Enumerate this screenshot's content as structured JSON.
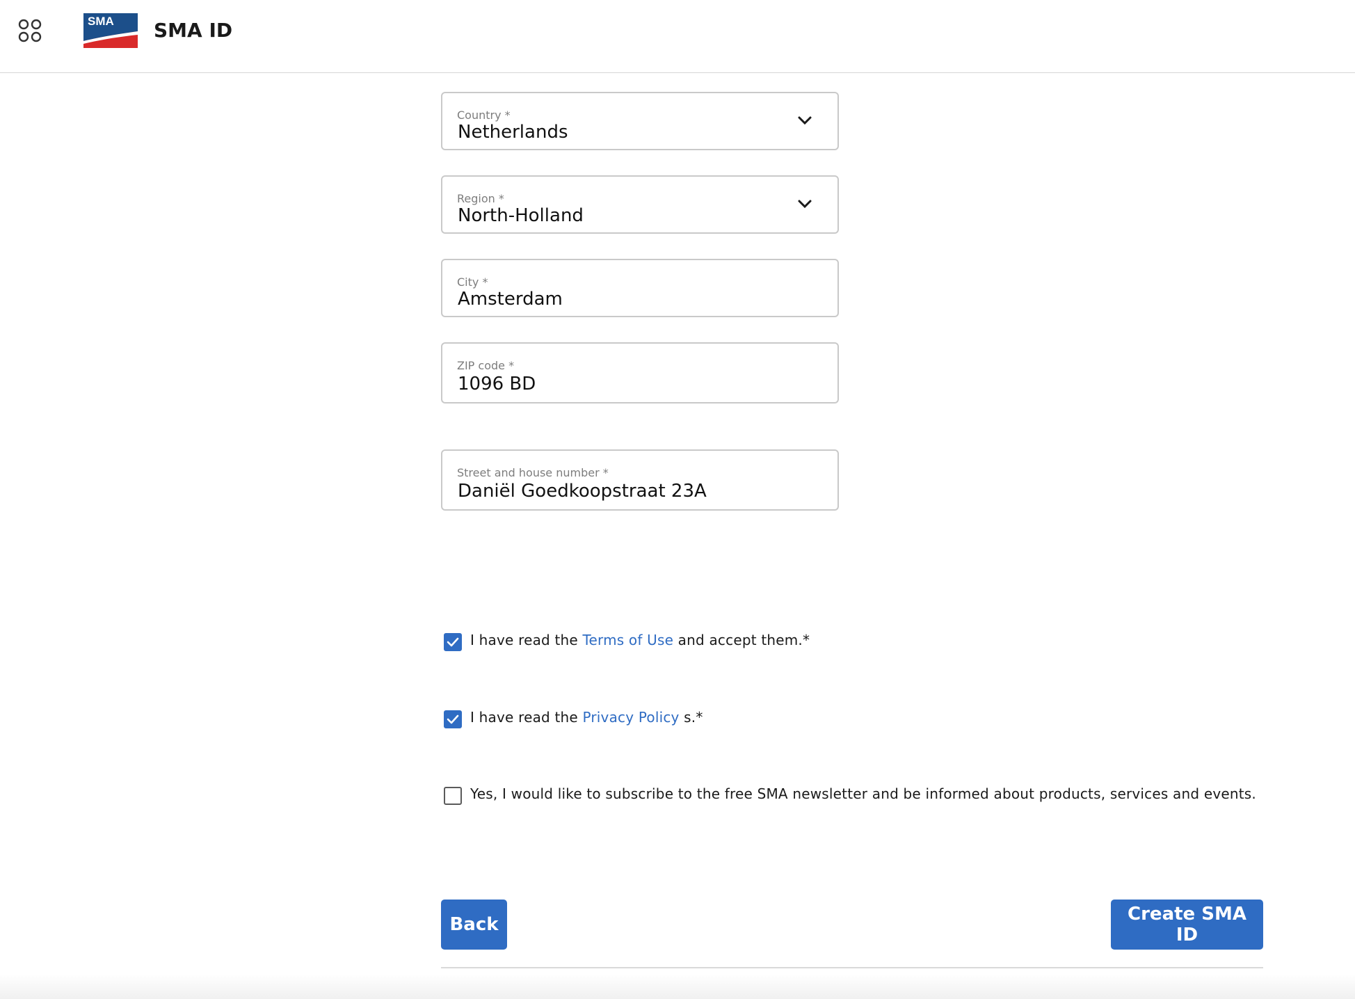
{
  "header": {
    "title": "SMA ID",
    "logo_text": "SMA",
    "apps_icon": "apps-grid-icon"
  },
  "form": {
    "country": {
      "label": "Country *",
      "value": "Netherlands",
      "icon": "chevron-down-icon"
    },
    "region": {
      "label": "Region *",
      "value": "North-Holland",
      "icon": "chevron-down-icon"
    },
    "city": {
      "label": "City *",
      "value": "Amsterdam"
    },
    "zip": {
      "label": "ZIP code *",
      "value": "1096 BD"
    },
    "street": {
      "label": "Street and house number *",
      "value": "Daniël Goedkoopstraat 23A"
    }
  },
  "consents": {
    "terms": {
      "checked": true,
      "prefix": "I have read the ",
      "link": "Terms of Use",
      "suffix": " and accept them.*"
    },
    "privacy": {
      "checked": true,
      "prefix": "I have read the ",
      "link": "Privacy Policy",
      "suffix": " s.*"
    },
    "newsletter": {
      "checked": false,
      "text": "Yes, I would like to subscribe to the free SMA newsletter and be informed about products, services and events."
    }
  },
  "buttons": {
    "back": "Back",
    "create": "Create SMA ID"
  },
  "colors": {
    "accent": "#2f6cc3",
    "logo_blue": "#1c4f8a",
    "logo_red": "#d92a2a"
  }
}
